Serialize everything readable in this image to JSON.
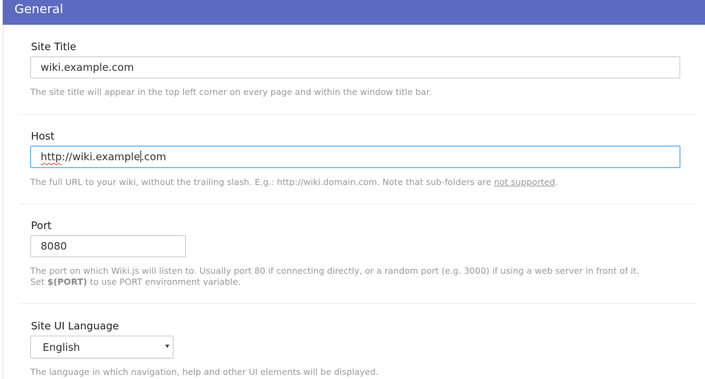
{
  "header": {
    "title": "General"
  },
  "fields": {
    "site_title": {
      "label": "Site Title",
      "value": "wiki.example.com",
      "help": "The site title will appear in the top left corner on every page and within the window title bar."
    },
    "host": {
      "label": "Host",
      "value_scheme": "http",
      "value_mid": "://wiki.example",
      "value_end": ".com",
      "help_prefix": "The full URL to your wiki, without the trailing slash. E.g.: http://wiki.domain.com. Note that sub-folders are ",
      "help_link": "not supported",
      "help_suffix": "."
    },
    "port": {
      "label": "Port",
      "value": "8080",
      "help_line1": "The port on which Wiki.js will listen to. Usually port 80 if connecting directly, or a random port (e.g. 3000) if using a web server in front of it.",
      "help_line2_prefix": "Set ",
      "help_line2_bold": "$(PORT)",
      "help_line2_suffix": " to use PORT environment variable."
    },
    "language": {
      "label": "Site UI Language",
      "selected": "English",
      "help": "The language in which navigation, help and other UI elements will be displayed."
    }
  },
  "colors": {
    "header_bg": "#5c6bc0",
    "focus_border": "#42a5f5",
    "spellcheck": "#e53935"
  },
  "icons": {
    "select_arrow": "caret-down-icon"
  }
}
